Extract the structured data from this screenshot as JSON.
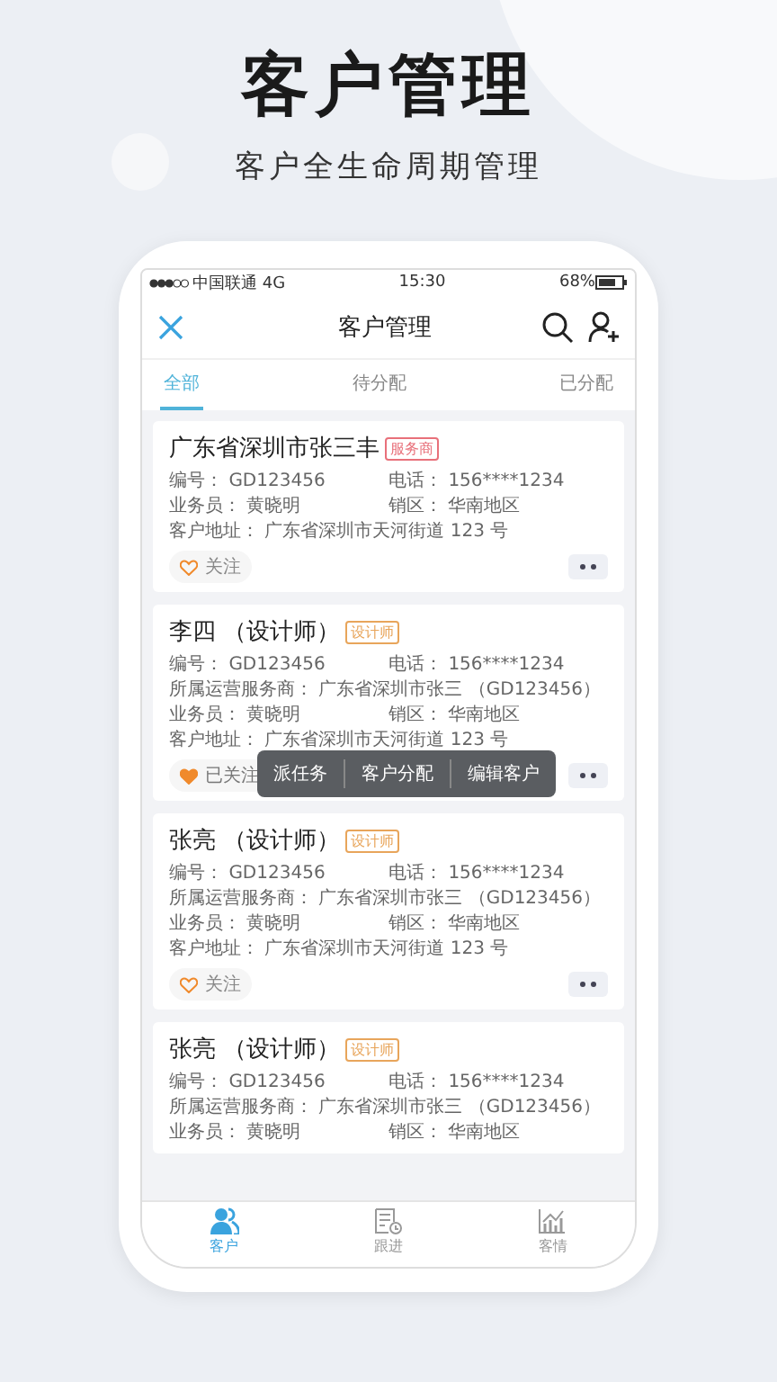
{
  "hero": {
    "title": "客户管理",
    "subtitle": "客户全生命周期管理"
  },
  "status_bar": {
    "carrier": "中国联通 4G",
    "time": "15:30",
    "battery": "68%"
  },
  "header": {
    "title": "客户管理"
  },
  "tabs": [
    {
      "label": "全部",
      "selected": true
    },
    {
      "label": "待分配",
      "selected": false
    },
    {
      "label": "已分配",
      "selected": false
    }
  ],
  "cards": [
    {
      "name": "广东省深圳市张三丰",
      "tag": {
        "label": "服务商",
        "kind": "service"
      },
      "rows": [
        [
          {
            "label": "编号：",
            "value": "GD123456"
          },
          {
            "label": "电话：",
            "value": "156****1234"
          }
        ],
        [
          {
            "label": "业务员：",
            "value": "黄晓明"
          },
          {
            "label": "销区：",
            "value": "华南地区"
          }
        ],
        [
          {
            "label": "客户地址：",
            "value": "广东省深圳市天河街道 123 号"
          }
        ]
      ],
      "follow": {
        "label": "关注",
        "followed": false
      }
    },
    {
      "name": "李四 （设计师）",
      "tag": {
        "label": "设计师",
        "kind": "designer"
      },
      "rows": [
        [
          {
            "label": "编号：",
            "value": "GD123456"
          },
          {
            "label": "电话：",
            "value": "156****1234"
          }
        ],
        [
          {
            "label": "所属运营服务商：",
            "value": "广东省深圳市张三 （GD123456）"
          }
        ],
        [
          {
            "label": "业务员：",
            "value": "黄晓明"
          },
          {
            "label": "销区：",
            "value": "华南地区"
          }
        ],
        [
          {
            "label": "客户地址：",
            "value": "广东省深圳市天河街道 123 号"
          }
        ]
      ],
      "follow": {
        "label": "已关注",
        "followed": true
      },
      "menu": [
        "派任务",
        "客户分配",
        "编辑客户"
      ]
    },
    {
      "name": "张亮 （设计师）",
      "tag": {
        "label": "设计师",
        "kind": "designer"
      },
      "rows": [
        [
          {
            "label": "编号：",
            "value": "GD123456"
          },
          {
            "label": "电话：",
            "value": "156****1234"
          }
        ],
        [
          {
            "label": "所属运营服务商：",
            "value": "广东省深圳市张三 （GD123456）"
          }
        ],
        [
          {
            "label": "业务员：",
            "value": "黄晓明"
          },
          {
            "label": "销区：",
            "value": "华南地区"
          }
        ],
        [
          {
            "label": "客户地址：",
            "value": "广东省深圳市天河街道 123 号"
          }
        ]
      ],
      "follow": {
        "label": "关注",
        "followed": false
      }
    },
    {
      "name": "张亮 （设计师）",
      "tag": {
        "label": "设计师",
        "kind": "designer"
      },
      "rows": [
        [
          {
            "label": "编号：",
            "value": "GD123456"
          },
          {
            "label": "电话：",
            "value": "156****1234"
          }
        ],
        [
          {
            "label": "所属运营服务商：",
            "value": "广东省深圳市张三 （GD123456）"
          }
        ],
        [
          {
            "label": "业务员：",
            "value": "黄晓明"
          },
          {
            "label": "销区：",
            "value": "华南地区"
          }
        ]
      ]
    }
  ],
  "bottom_nav": [
    {
      "label": "客户",
      "kind": "people",
      "selected": true
    },
    {
      "label": "跟进",
      "kind": "doc",
      "selected": false
    },
    {
      "label": "客情",
      "kind": "chart",
      "selected": false
    }
  ]
}
